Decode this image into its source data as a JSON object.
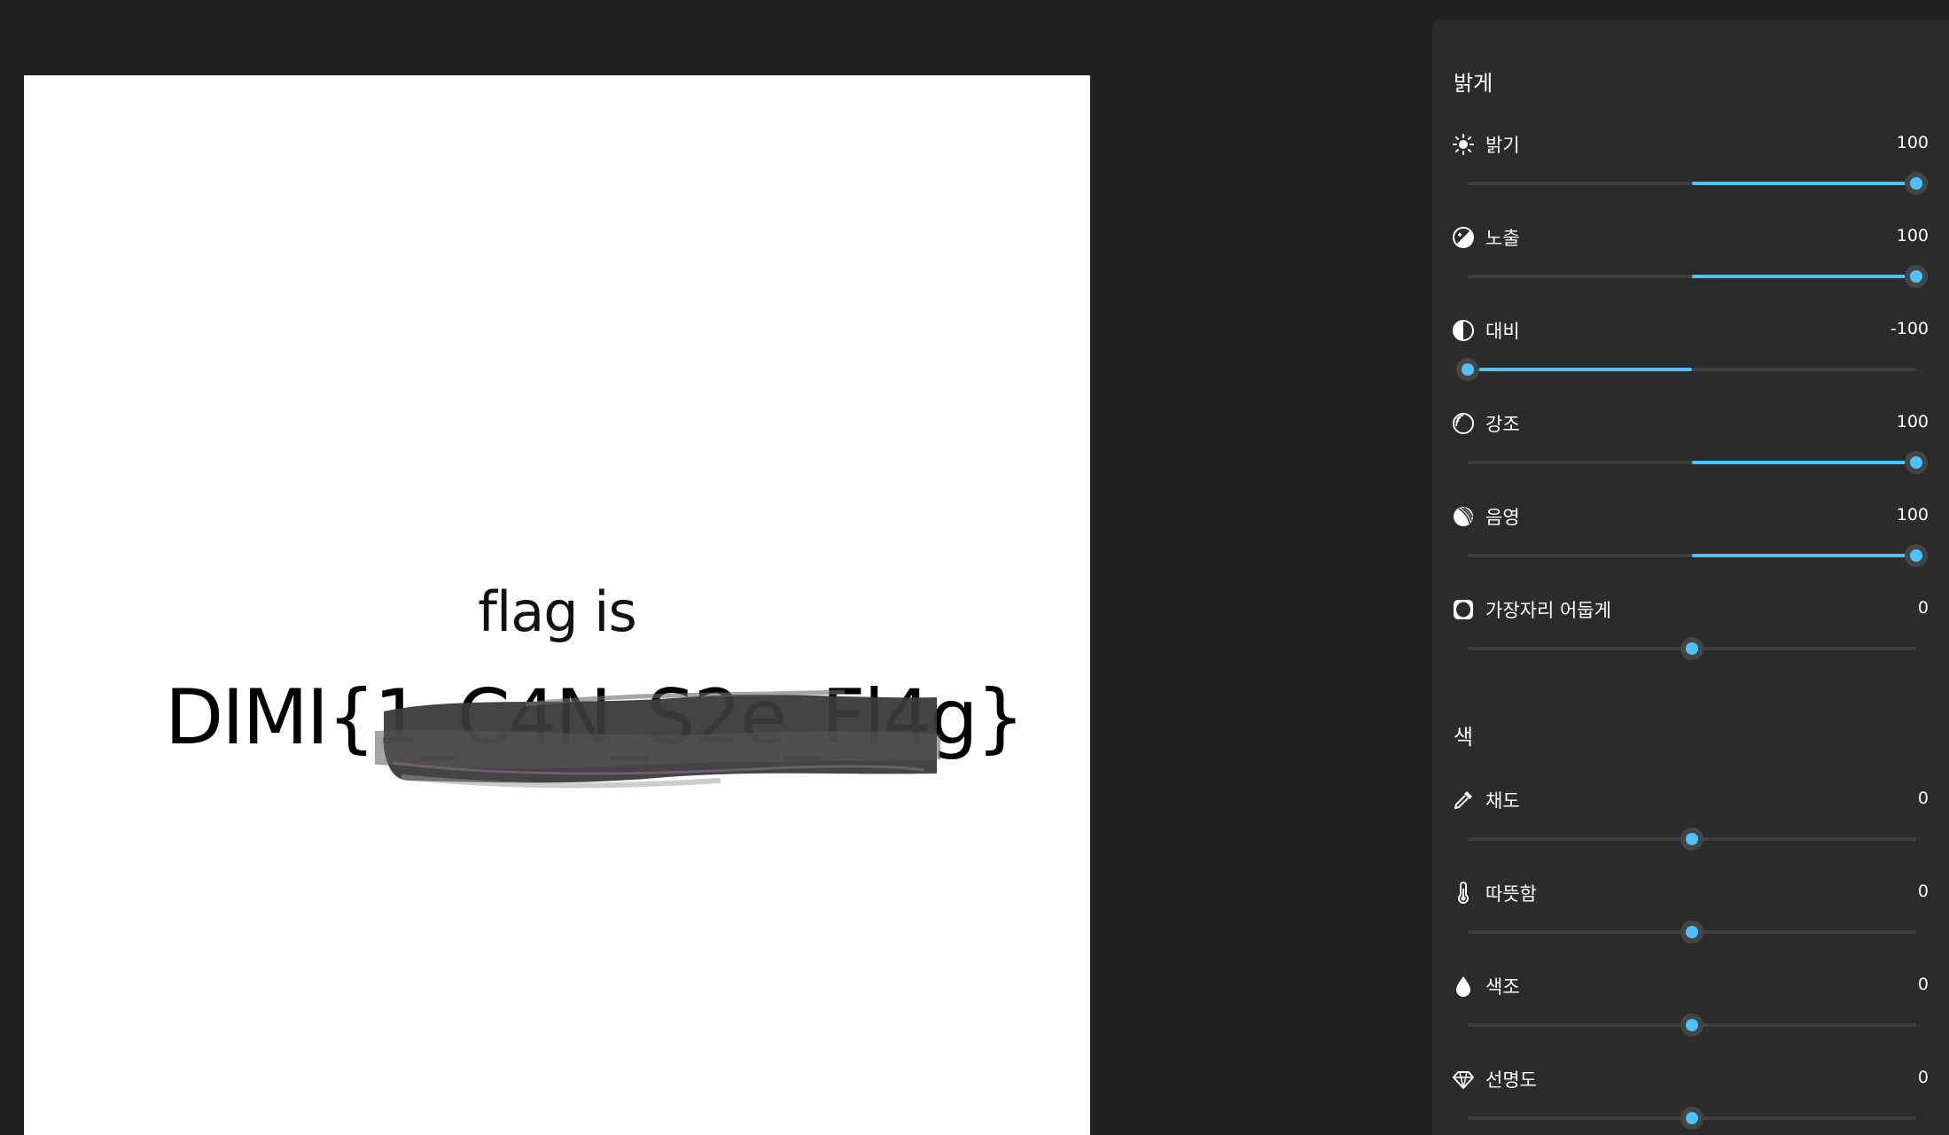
{
  "canvas": {
    "line1": "flag is",
    "line2": "DIMI{1_C4N_S2e_Fl4g}"
  },
  "panel": {
    "light_title": "밝게",
    "color_title": "색",
    "light": [
      {
        "id": "brightness",
        "icon": "sun-icon",
        "label": "밝기",
        "value": "100",
        "level": 100
      },
      {
        "id": "exposure",
        "icon": "exposure-icon",
        "label": "노출",
        "value": "100",
        "level": 100
      },
      {
        "id": "contrast",
        "icon": "contrast-icon",
        "label": "대비",
        "value": "-100",
        "level": -100
      },
      {
        "id": "highlights",
        "icon": "highlights-icon",
        "label": "강조",
        "value": "100",
        "level": 100
      },
      {
        "id": "shadows",
        "icon": "shadows-icon",
        "label": "음영",
        "value": "100",
        "level": 100
      },
      {
        "id": "vignette",
        "icon": "vignette-icon",
        "label": "가장자리 어둡게",
        "value": "0",
        "level": 0
      }
    ],
    "color": [
      {
        "id": "saturation",
        "icon": "eyedropper-icon",
        "label": "채도",
        "value": "0",
        "level": 0
      },
      {
        "id": "warmth",
        "icon": "thermometer-icon",
        "label": "따뜻함",
        "value": "0",
        "level": 0
      },
      {
        "id": "tint",
        "icon": "droplet-icon",
        "label": "색조",
        "value": "0",
        "level": 0
      },
      {
        "id": "clarity",
        "icon": "diamond-icon",
        "label": "선명도",
        "value": "0",
        "level": 0
      }
    ],
    "accent_color": "#4cc2ff"
  }
}
